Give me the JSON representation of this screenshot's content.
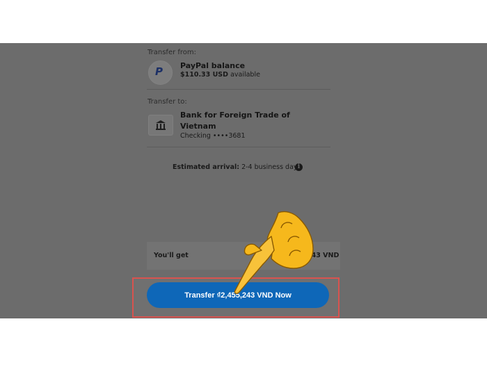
{
  "transfer_from": {
    "label": "Transfer from:",
    "account_name": "PayPal balance",
    "amount": "$110.33 USD",
    "amount_suffix": "available",
    "icon": "paypal-icon"
  },
  "transfer_to": {
    "label": "Transfer to:",
    "bank_name_line1": "Bank for Foreign Trade of",
    "bank_name_line2": "Vietnam",
    "account_detail": "Checking ••••3681",
    "icon": "bank-icon"
  },
  "arrival": {
    "label": "Estimated arrival:",
    "value": "2-4 business days",
    "info_icon": "info-icon"
  },
  "summary": {
    "label": "You'll get",
    "value_partial": "243 VND"
  },
  "cta": {
    "label": "Transfer ₫2,455,243 VND Now"
  },
  "colors": {
    "button": "#0e67b8",
    "highlight_border": "#d9534f",
    "overlay": "#6c6c6c",
    "hand": "#f6b81c"
  }
}
